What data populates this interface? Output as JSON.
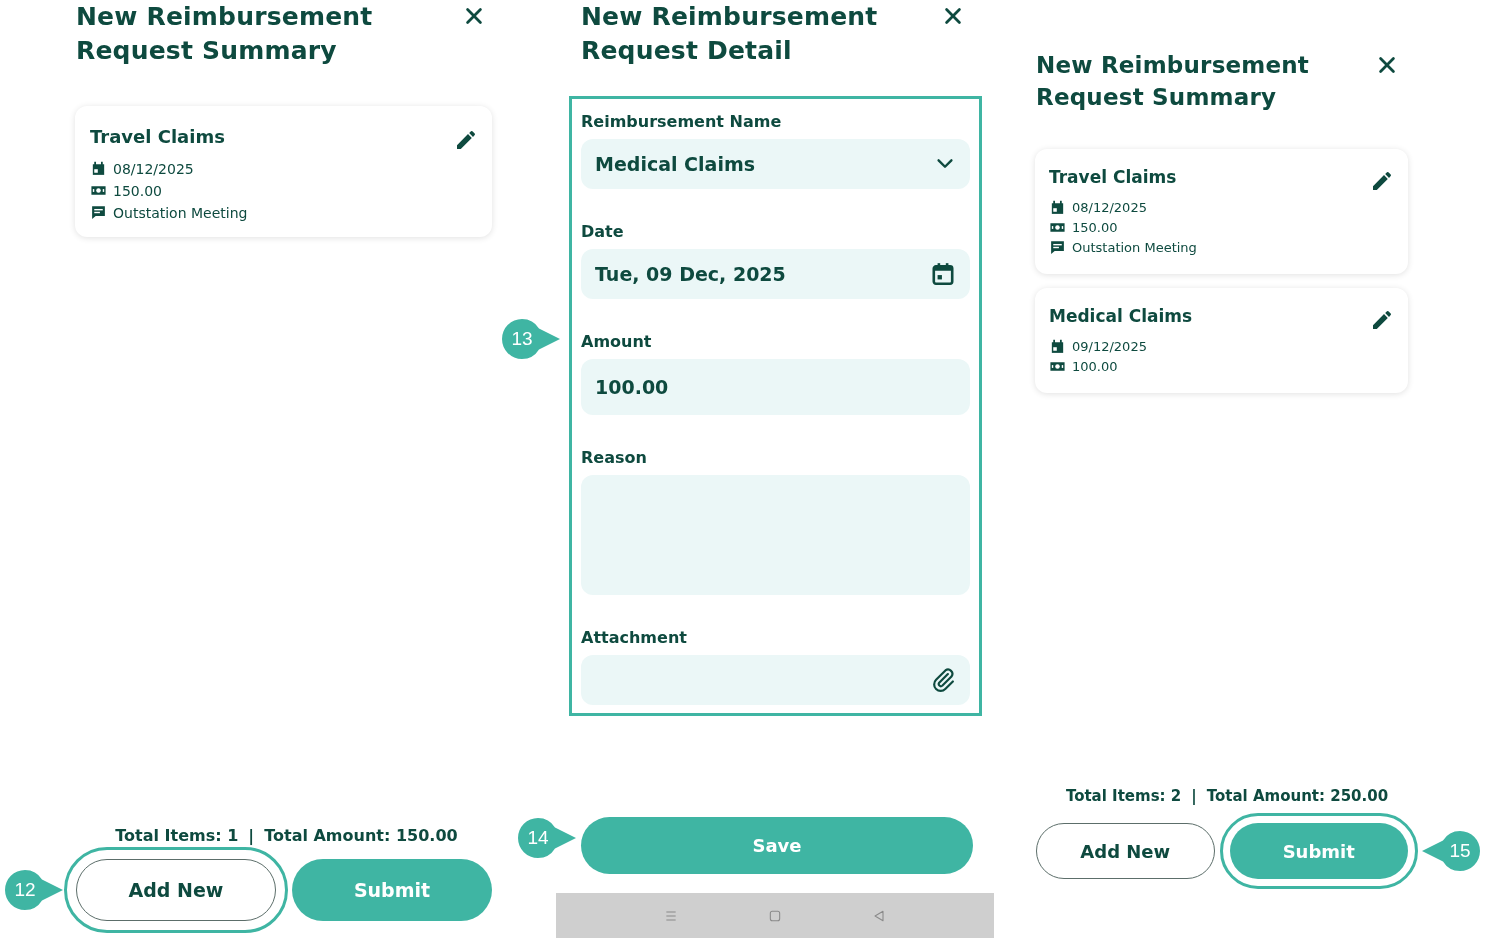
{
  "screens": [
    {
      "kind": "summary",
      "title": "New Reimbursement Request Summary",
      "cards": [
        {
          "title": "Travel Claims",
          "details": [
            {
              "kind": "date",
              "text": "08/12/2025"
            },
            {
              "kind": "amount",
              "text": "150.00"
            },
            {
              "kind": "note",
              "text": "Outstation Meeting"
            }
          ]
        }
      ],
      "totals": {
        "items": "Total Items: 1",
        "separator": "|",
        "amount": "Total Amount: 150.00"
      },
      "buttons": [
        {
          "kind": "outline",
          "label": "Add New",
          "highlighted": true,
          "callout": {
            "number": "12",
            "kind": "rightward"
          }
        },
        {
          "kind": "filled",
          "label": "Submit",
          "highlighted": false
        }
      ]
    },
    {
      "kind": "detail",
      "title": "New Reimbursement Request Detail",
      "form": {
        "highlighted": true,
        "callout": {
          "number": "13",
          "kind": "rightward"
        },
        "fields": [
          {
            "kind": "select",
            "label": "Reimbursement Name",
            "value": "Medical Claims"
          },
          {
            "kind": "date",
            "label": "Date",
            "value": "Tue, 09 Dec, 2025"
          },
          {
            "kind": "text",
            "label": "Amount",
            "value": "100.00"
          },
          {
            "kind": "textarea",
            "label": "Reason"
          },
          {
            "kind": "file",
            "label": "Attachment"
          }
        ]
      },
      "buttons": [
        {
          "kind": "filled",
          "label": "Save",
          "highlighted": false,
          "callout": {
            "number": "14",
            "kind": "rightward"
          }
        }
      ],
      "nav_bar": true
    },
    {
      "kind": "summary",
      "title": "New Reimbursement Request Summary",
      "cards": [
        {
          "title": "Travel Claims",
          "details": [
            {
              "kind": "date",
              "text": "08/12/2025"
            },
            {
              "kind": "amount",
              "text": "150.00"
            },
            {
              "kind": "note",
              "text": "Outstation Meeting"
            }
          ]
        },
        {
          "title": "Medical Claims",
          "details": [
            {
              "kind": "date",
              "text": "09/12/2025"
            },
            {
              "kind": "amount",
              "text": "100.00"
            }
          ]
        }
      ],
      "totals": {
        "items": "Total Items: 2",
        "separator": "|",
        "amount": "Total Amount: 250.00"
      },
      "buttons": [
        {
          "kind": "outline",
          "label": "Add New",
          "highlighted": false
        },
        {
          "kind": "filled",
          "label": "Submit",
          "highlighted": true,
          "callout": {
            "number": "15",
            "kind": "leftward"
          }
        }
      ]
    }
  ]
}
